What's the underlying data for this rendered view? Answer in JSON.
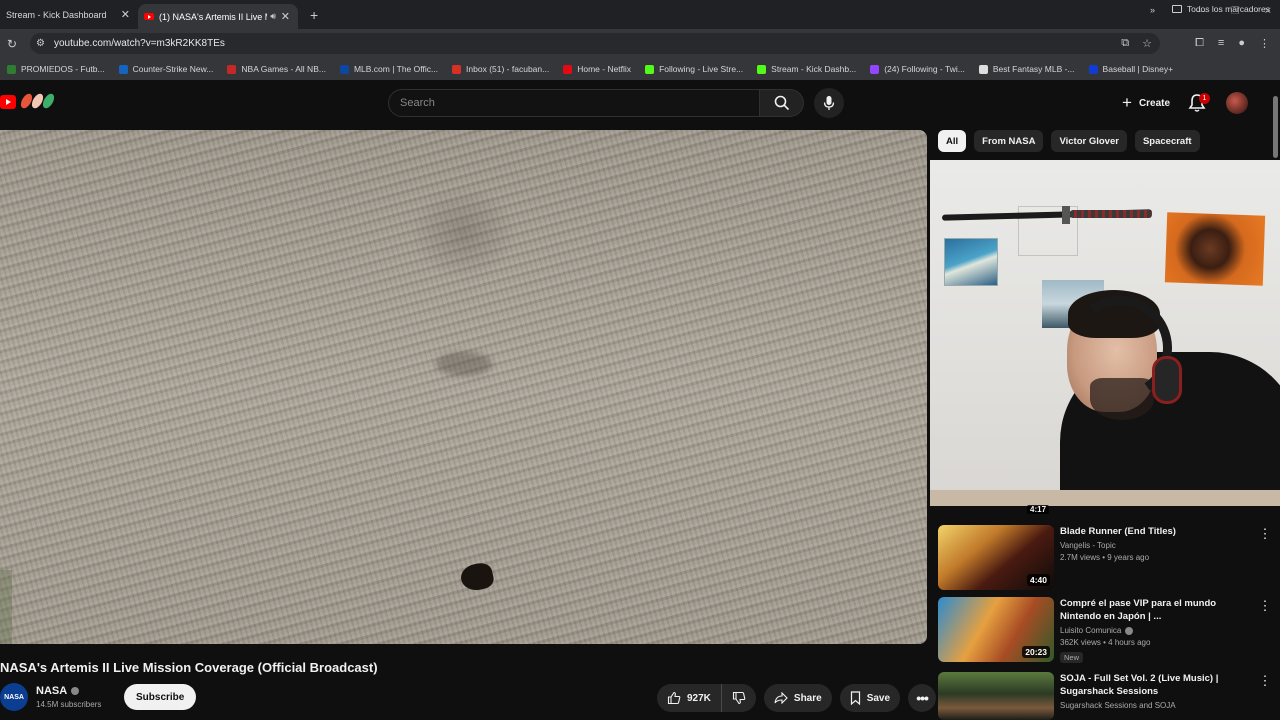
{
  "browser": {
    "tabs": [
      {
        "title": "Stream - Kick Dashboard",
        "active": false
      },
      {
        "title": "(1) NASA's Artemis II Live M",
        "active": true
      }
    ],
    "url": "youtube.com/watch?v=m3kR2KK8TEs",
    "bookmarks": [
      {
        "label": "PROMIEDOS - Futb...",
        "color": "#2e7d32"
      },
      {
        "label": "Counter-Strike New...",
        "color": "#1565c0"
      },
      {
        "label": "NBA Games - All NB...",
        "color": "#c62828"
      },
      {
        "label": "MLB.com | The Offic...",
        "color": "#0d47a1"
      },
      {
        "label": "Inbox (51) - facuban...",
        "color": "#d93025"
      },
      {
        "label": "Home - Netflix",
        "color": "#e50914"
      },
      {
        "label": "Following - Live Stre...",
        "color": "#53fc18"
      },
      {
        "label": "Stream - Kick Dashb...",
        "color": "#53fc18"
      },
      {
        "label": "(24) Following - Twi...",
        "color": "#9146ff"
      },
      {
        "label": "Best Fantasy MLB -...",
        "color": "#dddddd"
      },
      {
        "label": "Baseball | Disney+",
        "color": "#113ccf"
      }
    ],
    "all_bookmarks_label": "Todos los marcadores"
  },
  "masthead": {
    "search_placeholder": "Search",
    "create_label": "Create",
    "notification_count": "1"
  },
  "chips": [
    {
      "label": "All",
      "selected": true
    },
    {
      "label": "From NASA",
      "selected": false
    },
    {
      "label": "Victor Glover",
      "selected": false
    },
    {
      "label": "Spacecraft",
      "selected": false
    }
  ],
  "partial_video": {
    "duration": "4:17"
  },
  "recommendations": [
    {
      "title": "Blade Runner (End Titles)",
      "channel": "Vangelis - Topic",
      "meta": "2.7M views • 9 years ago",
      "duration": "4:40",
      "verified": false,
      "badge": ""
    },
    {
      "title": "Compré el pase VIP para el mundo Nintendo en Japón | ...",
      "channel": "Luisito Comunica",
      "meta": "362K views • 4 hours ago",
      "duration": "20:23",
      "verified": true,
      "badge": "New"
    },
    {
      "title": "SOJA - Full Set Vol. 2 (Live Music) | Sugarshack Sessions",
      "channel": "Sugarshack Sessions and SOJA",
      "meta": "",
      "duration": "",
      "verified": false,
      "badge": ""
    }
  ],
  "video": {
    "title": "NASA's Artemis II Live Mission Coverage (Official Broadcast)",
    "channel": "NASA",
    "channel_avatar_text": "NASA",
    "subscribers": "14.5M subscribers",
    "subscribe_label": "Subscribe",
    "likes": "927K",
    "share_label": "Share",
    "save_label": "Save"
  }
}
